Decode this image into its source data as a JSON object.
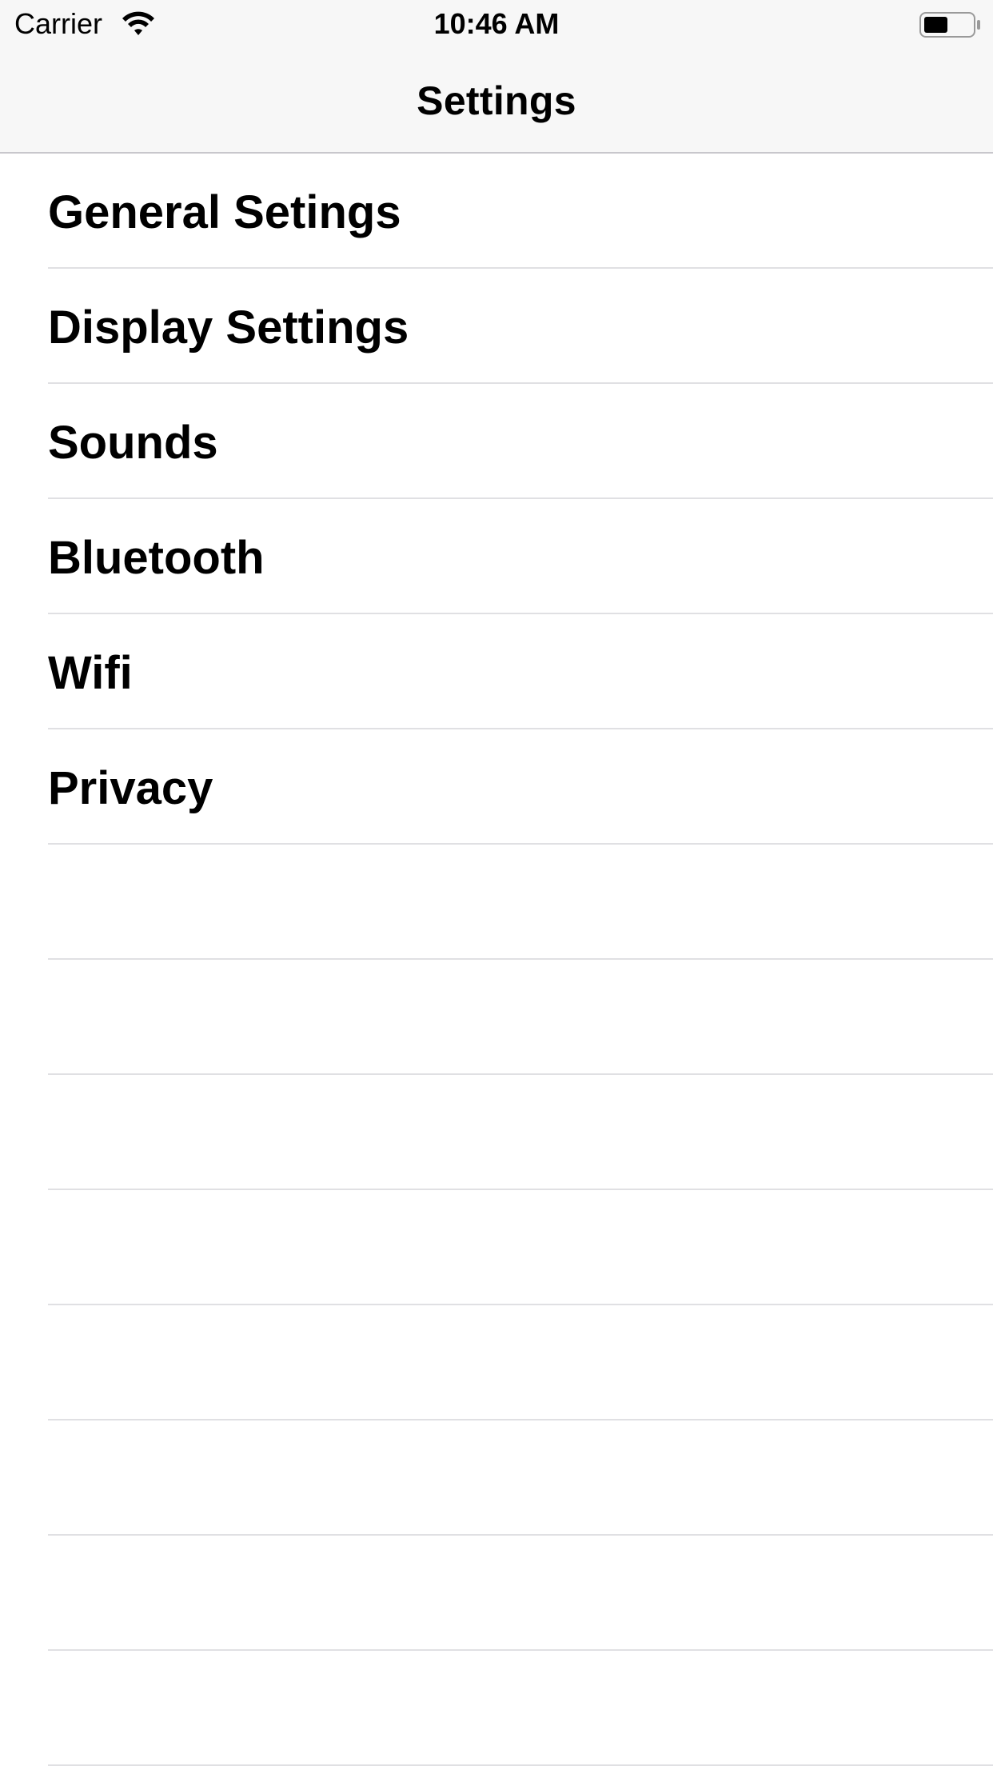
{
  "status_bar": {
    "carrier": "Carrier",
    "time": "10:46 AM",
    "wifi_icon": "wifi-icon",
    "battery_icon": "battery-icon",
    "battery_level": 0.5
  },
  "nav": {
    "title": "Settings"
  },
  "settings_list": {
    "items": [
      {
        "label": "General Setings"
      },
      {
        "label": "Display Settings"
      },
      {
        "label": "Sounds"
      },
      {
        "label": "Bluetooth"
      },
      {
        "label": "Wifi"
      },
      {
        "label": "Privacy"
      }
    ],
    "empty_rows": 8
  },
  "colors": {
    "nav_background": "#f7f7f7",
    "separator": "#e0e0e3",
    "text": "#000000",
    "background": "#ffffff"
  }
}
